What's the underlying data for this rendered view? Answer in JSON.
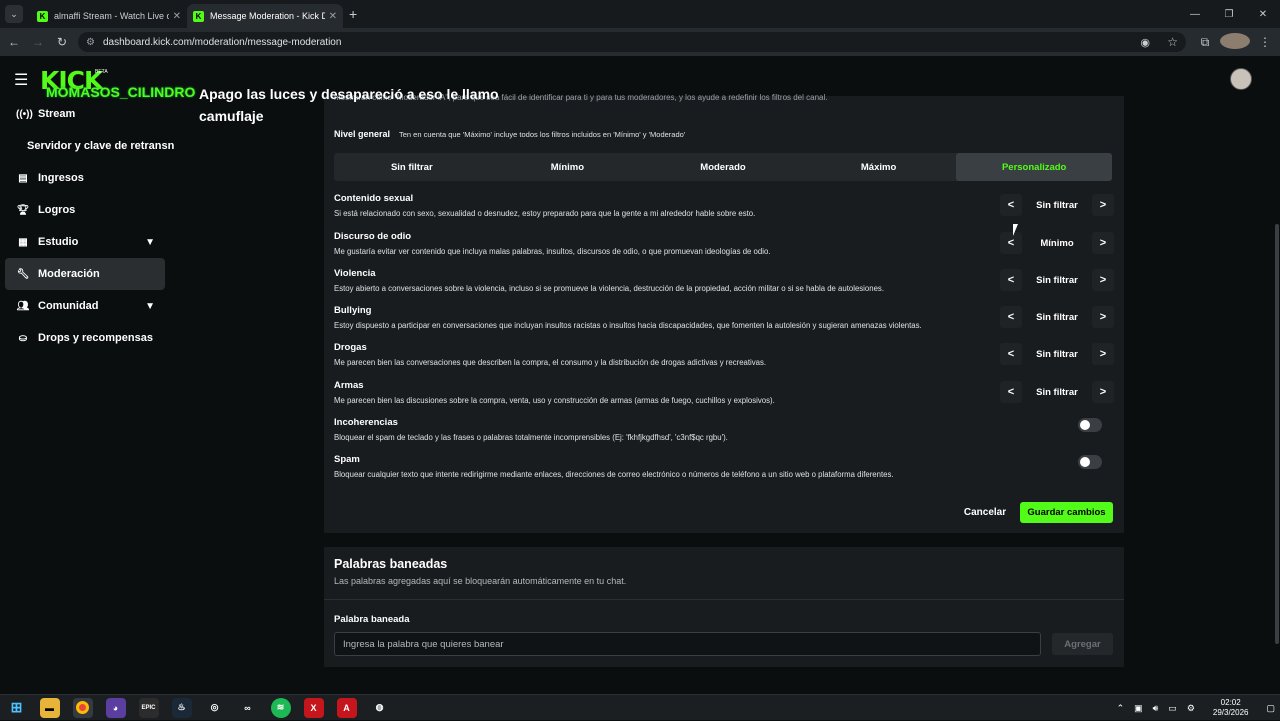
{
  "browser": {
    "tabs": [
      {
        "title": "almaffi Stream - Watch Live on",
        "active": false
      },
      {
        "title": "Message Moderation - Kick Da",
        "active": true
      }
    ],
    "url": "dashboard.kick.com/moderation/message-moderation"
  },
  "header": {
    "logo": "KICK",
    "beta": "BETA",
    "overlay_username": "MOMASOS_CILINDRO",
    "overlay_title": "Apago las luces y desapareció a eso le llamo camuflaje"
  },
  "sidebar": {
    "items": [
      {
        "label": "Stream",
        "icon": "broadcast-icon"
      },
      {
        "label": "Servidor y clave de retransn",
        "icon": ""
      },
      {
        "label": "Ingresos",
        "icon": "chart-icon"
      },
      {
        "label": "Logros",
        "icon": "trophy-icon"
      },
      {
        "label": "Estudio",
        "icon": "studio-icon"
      },
      {
        "label": "Moderación",
        "icon": "wrench-icon"
      },
      {
        "label": "Comunidad",
        "icon": "users-icon"
      },
      {
        "label": "Drops y recompensas",
        "icon": "gift-icon"
      }
    ]
  },
  "moderation": {
    "cut_text": "mostrarán como \"Moderador IA\", para que sea fácil de identificar para ti y para tus moderadores, y los ayude a redefinir los filtros del canal.",
    "nivel_label": "Nivel general",
    "nivel_desc": "Ten en cuenta que 'Máximo' incluye todos los filtros incluidos en 'Mínimo' y 'Moderado'",
    "levels": [
      "Sin filtrar",
      "Mínimo",
      "Moderado",
      "Máximo",
      "Personalizado"
    ],
    "selected_level": "Personalizado",
    "filters": [
      {
        "name": "Contenido sexual",
        "desc": "Si está relacionado con sexo, sexualidad o desnudez, estoy preparado para que la gente a mi alrededor hable sobre esto.",
        "value": "Sin filtrar"
      },
      {
        "name": "Discurso de odio",
        "desc": "Me gustaría evitar ver contenido que incluya malas palabras, insultos, discursos de odio, o que promuevan ideologías de odio.",
        "value": "Mínimo"
      },
      {
        "name": "Violencia",
        "desc": "Estoy abierto a conversaciones sobre la violencia, incluso si se promueve la violencia, destrucción de la propiedad, acción militar o si se habla de autolesiones.",
        "value": "Sin filtrar"
      },
      {
        "name": "Bullying",
        "desc": "Estoy dispuesto a participar en conversaciones que incluyan insultos racistas o insultos hacia discapacidades, que fomenten la autolesión y sugieran amenazas violentas.",
        "value": "Sin filtrar"
      },
      {
        "name": "Drogas",
        "desc": "Me parecen bien las conversaciones que describen la compra, el consumo y la distribución de drogas adictivas y recreativas.",
        "value": "Sin filtrar"
      },
      {
        "name": "Armas",
        "desc": "Me parecen bien las discusiones sobre la compra, venta, uso y construcción de armas (armas de fuego, cuchillos y explosivos).",
        "value": "Sin filtrar"
      }
    ],
    "toggles": [
      {
        "name": "Incoherencias",
        "desc": "Bloquear el spam de teclado y las frases o palabras totalmente incomprensibles (Ej: 'fkhfjkgdfhsd', 'c3nf$qc rgbu').",
        "on": false
      },
      {
        "name": "Spam",
        "desc": "Bloquear cualquier texto que intente redirigirme mediante enlaces, direcciones de correo electrónico o números de teléfono a un sitio web o plataforma diferentes.",
        "on": false
      }
    ],
    "cancel_label": "Cancelar",
    "save_label": "Guardar cambios"
  },
  "banned": {
    "title": "Palabras baneadas",
    "subtitle": "Las palabras agregadas aquí se bloquearán automáticamente en tu chat.",
    "field_label": "Palabra baneada",
    "placeholder": "Ingresa la palabra que quieres banear",
    "add_label": "Agregar"
  },
  "taskbar": {
    "time": "02:02",
    "date": "29/3/2026"
  },
  "colors": {
    "accent": "#53fc18",
    "background": "#0b0e0f",
    "card": "#191c1f"
  }
}
